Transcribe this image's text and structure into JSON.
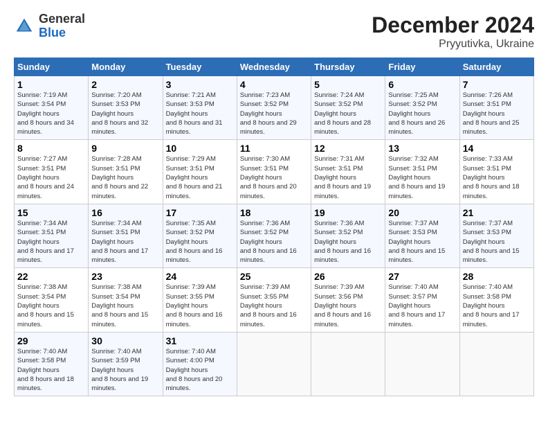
{
  "logo": {
    "line1": "General",
    "line2": "Blue"
  },
  "title": "December 2024",
  "subtitle": "Pryyutivka, Ukraine",
  "days_header": [
    "Sunday",
    "Monday",
    "Tuesday",
    "Wednesday",
    "Thursday",
    "Friday",
    "Saturday"
  ],
  "weeks": [
    [
      {
        "day": "1",
        "sunrise": "7:19 AM",
        "sunset": "3:54 PM",
        "daylight": "8 hours and 34 minutes."
      },
      {
        "day": "2",
        "sunrise": "7:20 AM",
        "sunset": "3:53 PM",
        "daylight": "8 hours and 32 minutes."
      },
      {
        "day": "3",
        "sunrise": "7:21 AM",
        "sunset": "3:53 PM",
        "daylight": "8 hours and 31 minutes."
      },
      {
        "day": "4",
        "sunrise": "7:23 AM",
        "sunset": "3:52 PM",
        "daylight": "8 hours and 29 minutes."
      },
      {
        "day": "5",
        "sunrise": "7:24 AM",
        "sunset": "3:52 PM",
        "daylight": "8 hours and 28 minutes."
      },
      {
        "day": "6",
        "sunrise": "7:25 AM",
        "sunset": "3:52 PM",
        "daylight": "8 hours and 26 minutes."
      },
      {
        "day": "7",
        "sunrise": "7:26 AM",
        "sunset": "3:51 PM",
        "daylight": "8 hours and 25 minutes."
      }
    ],
    [
      {
        "day": "8",
        "sunrise": "7:27 AM",
        "sunset": "3:51 PM",
        "daylight": "8 hours and 24 minutes."
      },
      {
        "day": "9",
        "sunrise": "7:28 AM",
        "sunset": "3:51 PM",
        "daylight": "8 hours and 22 minutes."
      },
      {
        "day": "10",
        "sunrise": "7:29 AM",
        "sunset": "3:51 PM",
        "daylight": "8 hours and 21 minutes."
      },
      {
        "day": "11",
        "sunrise": "7:30 AM",
        "sunset": "3:51 PM",
        "daylight": "8 hours and 20 minutes."
      },
      {
        "day": "12",
        "sunrise": "7:31 AM",
        "sunset": "3:51 PM",
        "daylight": "8 hours and 19 minutes."
      },
      {
        "day": "13",
        "sunrise": "7:32 AM",
        "sunset": "3:51 PM",
        "daylight": "8 hours and 19 minutes."
      },
      {
        "day": "14",
        "sunrise": "7:33 AM",
        "sunset": "3:51 PM",
        "daylight": "8 hours and 18 minutes."
      }
    ],
    [
      {
        "day": "15",
        "sunrise": "7:34 AM",
        "sunset": "3:51 PM",
        "daylight": "8 hours and 17 minutes."
      },
      {
        "day": "16",
        "sunrise": "7:34 AM",
        "sunset": "3:51 PM",
        "daylight": "8 hours and 17 minutes."
      },
      {
        "day": "17",
        "sunrise": "7:35 AM",
        "sunset": "3:52 PM",
        "daylight": "8 hours and 16 minutes."
      },
      {
        "day": "18",
        "sunrise": "7:36 AM",
        "sunset": "3:52 PM",
        "daylight": "8 hours and 16 minutes."
      },
      {
        "day": "19",
        "sunrise": "7:36 AM",
        "sunset": "3:52 PM",
        "daylight": "8 hours and 16 minutes."
      },
      {
        "day": "20",
        "sunrise": "7:37 AM",
        "sunset": "3:53 PM",
        "daylight": "8 hours and 15 minutes."
      },
      {
        "day": "21",
        "sunrise": "7:37 AM",
        "sunset": "3:53 PM",
        "daylight": "8 hours and 15 minutes."
      }
    ],
    [
      {
        "day": "22",
        "sunrise": "7:38 AM",
        "sunset": "3:54 PM",
        "daylight": "8 hours and 15 minutes."
      },
      {
        "day": "23",
        "sunrise": "7:38 AM",
        "sunset": "3:54 PM",
        "daylight": "8 hours and 15 minutes."
      },
      {
        "day": "24",
        "sunrise": "7:39 AM",
        "sunset": "3:55 PM",
        "daylight": "8 hours and 16 minutes."
      },
      {
        "day": "25",
        "sunrise": "7:39 AM",
        "sunset": "3:55 PM",
        "daylight": "8 hours and 16 minutes."
      },
      {
        "day": "26",
        "sunrise": "7:39 AM",
        "sunset": "3:56 PM",
        "daylight": "8 hours and 16 minutes."
      },
      {
        "day": "27",
        "sunrise": "7:40 AM",
        "sunset": "3:57 PM",
        "daylight": "8 hours and 17 minutes."
      },
      {
        "day": "28",
        "sunrise": "7:40 AM",
        "sunset": "3:58 PM",
        "daylight": "8 hours and 17 minutes."
      }
    ],
    [
      {
        "day": "29",
        "sunrise": "7:40 AM",
        "sunset": "3:58 PM",
        "daylight": "8 hours and 18 minutes."
      },
      {
        "day": "30",
        "sunrise": "7:40 AM",
        "sunset": "3:59 PM",
        "daylight": "8 hours and 19 minutes."
      },
      {
        "day": "31",
        "sunrise": "7:40 AM",
        "sunset": "4:00 PM",
        "daylight": "8 hours and 20 minutes."
      },
      null,
      null,
      null,
      null
    ]
  ]
}
